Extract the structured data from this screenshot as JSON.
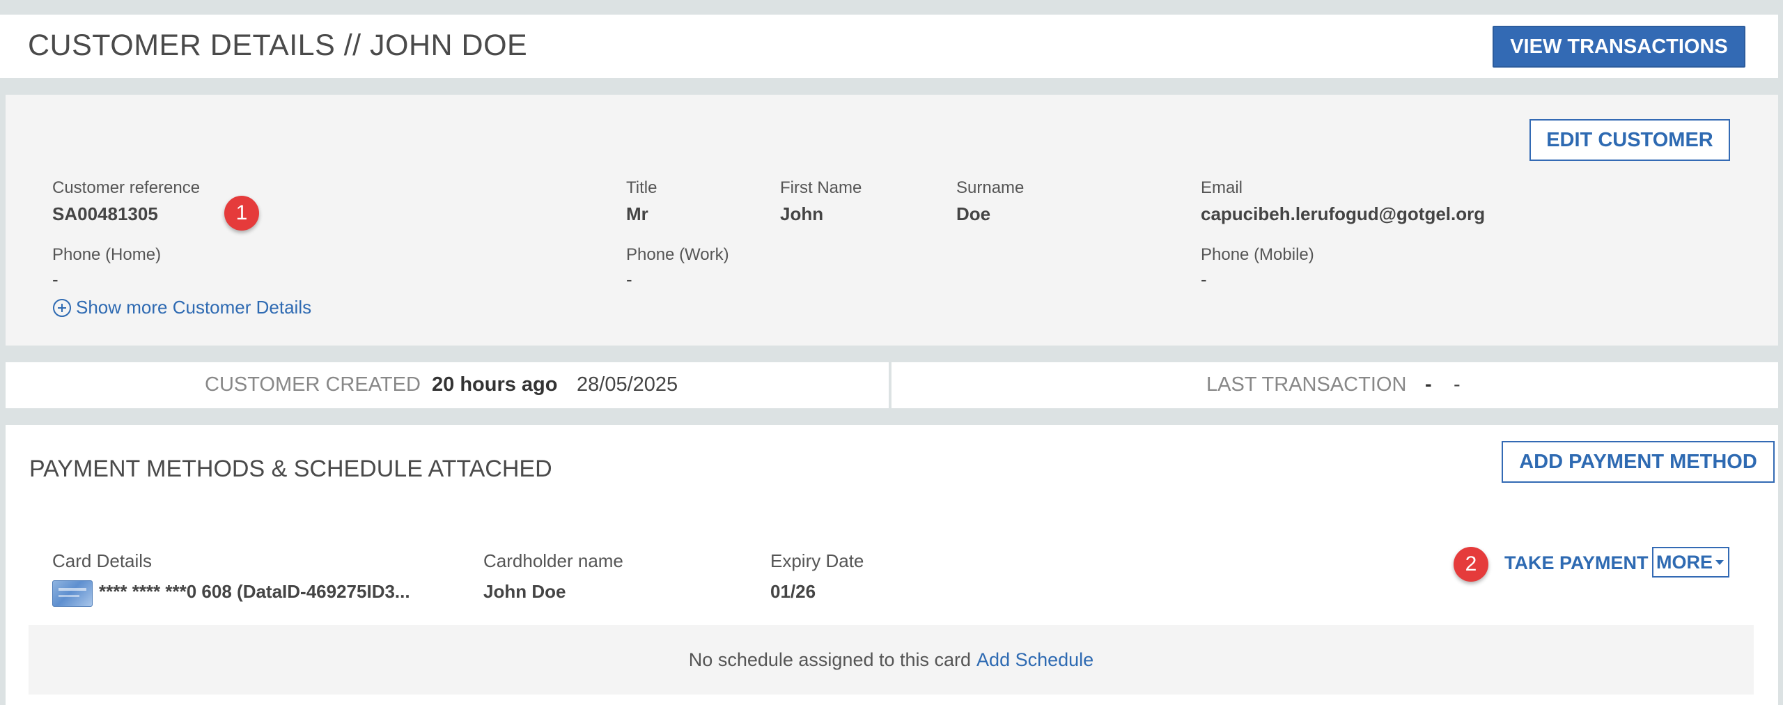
{
  "header": {
    "title": "CUSTOMER DETAILS // JOHN DOE",
    "view_transactions_label": "VIEW TRANSACTIONS"
  },
  "details": {
    "edit_label": "EDIT CUSTOMER",
    "customer_reference": {
      "label": "Customer reference",
      "value": "SA00481305"
    },
    "title": {
      "label": "Title",
      "value": "Mr"
    },
    "first_name": {
      "label": "First Name",
      "value": "John"
    },
    "surname": {
      "label": "Surname",
      "value": "Doe"
    },
    "email": {
      "label": "Email",
      "value": "capucibeh.lerufogud@gotgel.org"
    },
    "phone_home": {
      "label": "Phone (Home)",
      "value": "-"
    },
    "phone_work": {
      "label": "Phone (Work)",
      "value": "-"
    },
    "phone_mobile": {
      "label": "Phone (Mobile)",
      "value": "-"
    },
    "show_more_icon": "plus-circle-icon",
    "show_more_label": "Show more Customer Details"
  },
  "badges": {
    "one": "1",
    "two": "2",
    "color": "#e53b3b"
  },
  "stats": {
    "created_label": "CUSTOMER CREATED",
    "created_relative": "20 hours ago",
    "created_date": "28/05/2025",
    "last_tx_label": "LAST TRANSACTION",
    "last_tx_value1": "-",
    "last_tx_value2": "-"
  },
  "payment": {
    "title": "PAYMENT METHODS & SCHEDULE ATTACHED",
    "add_label": "ADD PAYMENT METHOD",
    "card_details_label": "Card Details",
    "card_icon": "credit-card-icon",
    "card_number": "**** **** ***0 608 (DataID-469275ID3...",
    "cardholder_label": "Cardholder name",
    "cardholder_value": "John Doe",
    "expiry_label": "Expiry Date",
    "expiry_value": "01/26",
    "take_payment_label": "TAKE PAYMENT",
    "more_label": "MORE",
    "more_icon": "caret-down-icon",
    "no_schedule_text": "No schedule assigned to this card",
    "add_schedule_label": "Add Schedule"
  },
  "colors": {
    "primary": "#336ab4",
    "background": "#dce2e3",
    "panel": "#f4f4f4"
  }
}
